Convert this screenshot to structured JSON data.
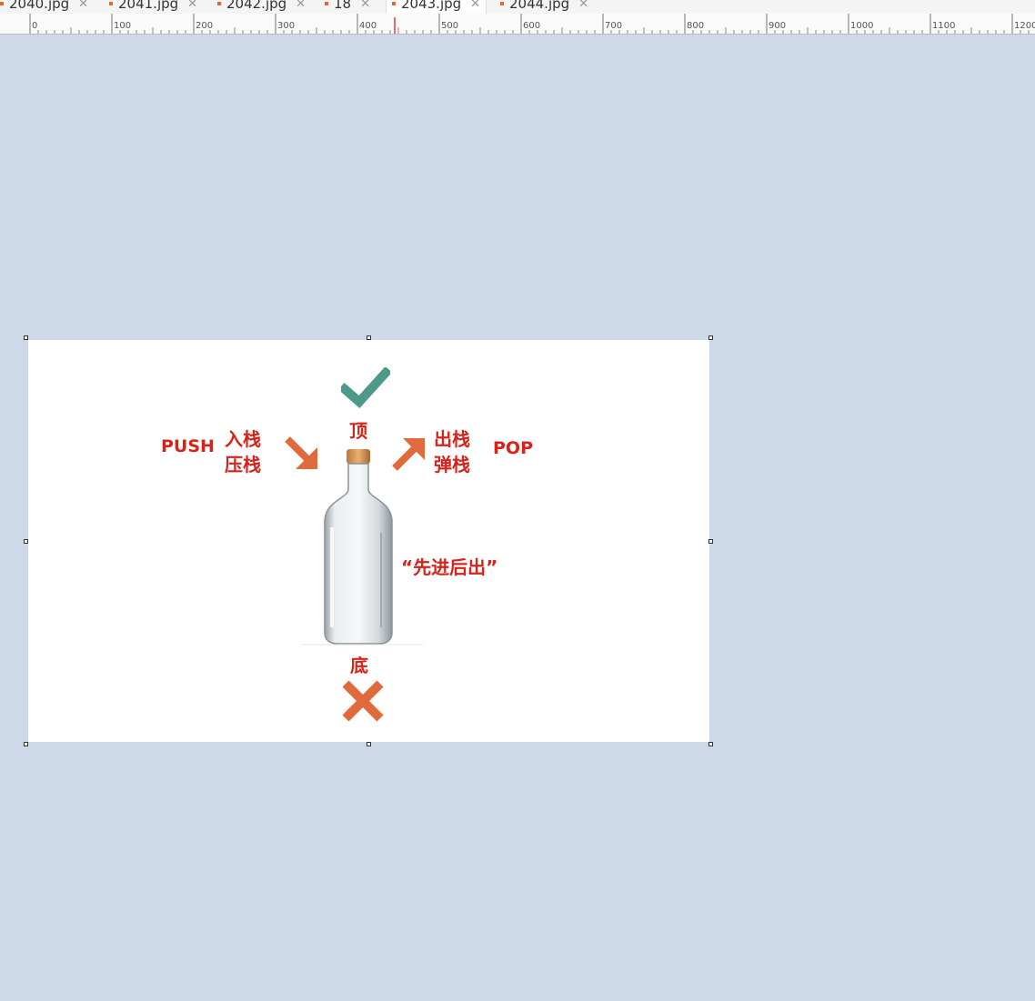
{
  "tabs": [
    {
      "label": "2040.jpg",
      "active": false
    },
    {
      "label": "2041.jpg",
      "active": false
    },
    {
      "label": "2042.jpg",
      "active": false
    },
    {
      "label": "18",
      "active": false
    },
    {
      "label": "2043.jpg",
      "active": true
    },
    {
      "label": "2044.jpg",
      "active": false
    }
  ],
  "ruler": {
    "labels": [
      "0",
      "100",
      "200",
      "300",
      "400",
      "500",
      "600",
      "700",
      "800",
      "900",
      "1000",
      "1100",
      "1200"
    ]
  },
  "image": {
    "top_label": "顶",
    "bottom_label": "底",
    "push_label": "PUSH",
    "push_cn_1": "入栈",
    "push_cn_2": "压栈",
    "pop_label": "POP",
    "pop_cn_1": "出栈",
    "pop_cn_2": "弹栈",
    "lifo_text": "“先进后出”"
  },
  "colors": {
    "canvas_bg": "#cdd9e8",
    "accent_red": "#d8231b",
    "arrow_orange": "#e06a3c",
    "check_green": "#4e9a8a",
    "cross_orange": "#e06a3c"
  }
}
